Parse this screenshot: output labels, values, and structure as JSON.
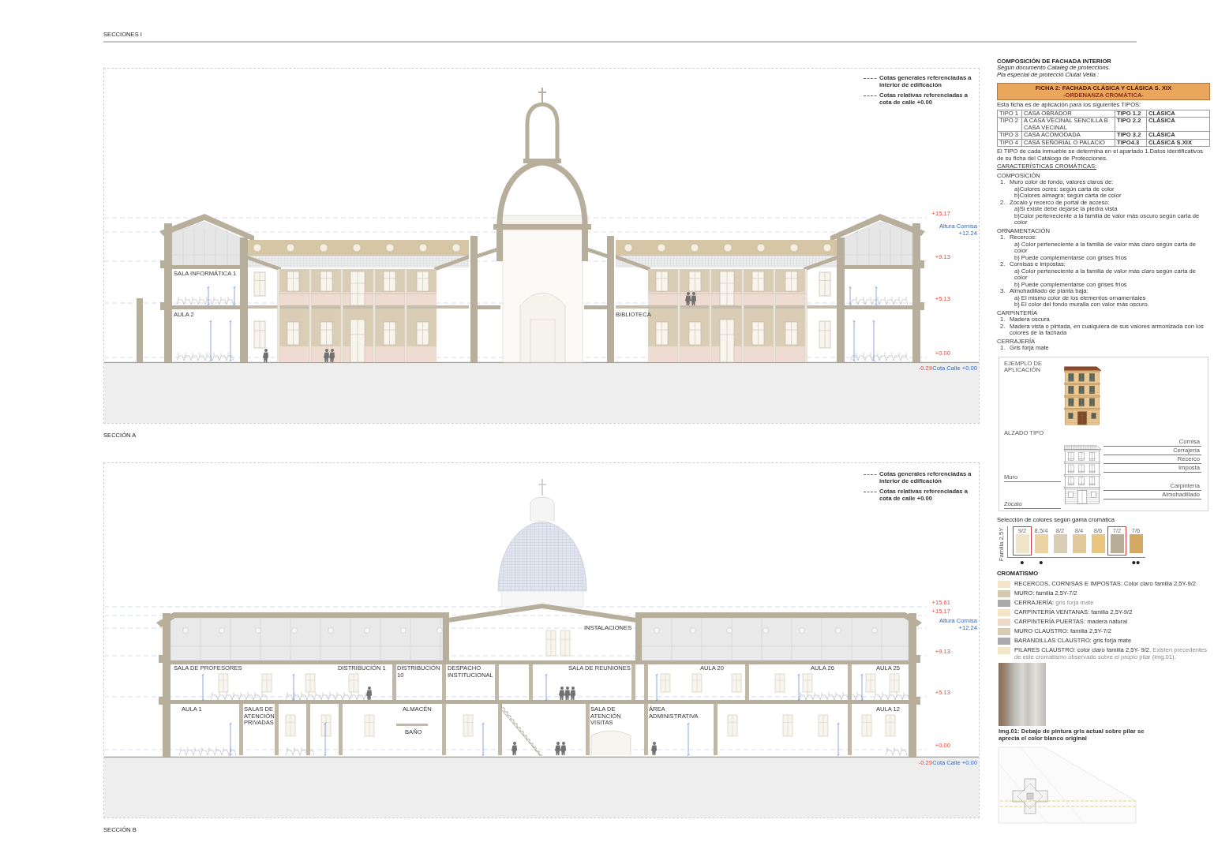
{
  "header": {
    "title": "SECCIONES I"
  },
  "sections": [
    {
      "kind": "chapel",
      "caption": "SECCIÓN A",
      "legend": [
        {
          "kind": "general",
          "text": "Cotas generales referenciadas a interior de edificación"
        },
        {
          "kind": "relative",
          "text": "Cotas relativas referenciadas a cota de calle +0.00"
        }
      ],
      "levels": [
        {
          "text": "+15.17",
          "kind": "general"
        },
        {
          "text": "Altura Cornisa +12.24",
          "kind": "relative"
        },
        {
          "text": "+9.13",
          "kind": "general"
        },
        {
          "text": "+5.13",
          "kind": "general"
        },
        {
          "text": "+0.00",
          "kind": "general"
        },
        {
          "text": "-0.29",
          "kind": "general"
        },
        {
          "text": "Cota Calle +0.00",
          "kind": "relative"
        }
      ],
      "rooms": [
        "SALA INFORMÁTICA 1",
        "AULA 2",
        "BIBLIOTECA"
      ]
    },
    {
      "kind": "offices",
      "caption": "SECCIÓN B",
      "legend": [
        {
          "kind": "general",
          "text": "Cotas generales referenciadas a interior de edificación"
        },
        {
          "kind": "relative",
          "text": "Cotas relativas referenciadas a cota de calle +0.00"
        }
      ],
      "levels": [
        {
          "text": "+15.61",
          "kind": "general"
        },
        {
          "text": "+15.17",
          "kind": "general"
        },
        {
          "text": "Altura Cornisa +12.24",
          "kind": "relative"
        },
        {
          "text": "+9.13",
          "kind": "general"
        },
        {
          "text": "+5.13",
          "kind": "general"
        },
        {
          "text": "+0.00",
          "kind": "general"
        },
        {
          "text": "-0.29",
          "kind": "general"
        },
        {
          "text": "Cota Calle +0.00",
          "kind": "relative"
        }
      ],
      "rooms": [
        "INSTALACIONES",
        "SALA DE PROFESORES",
        "DISTRIBUCIÓN 1",
        "DISTRIBUCIÓN 10",
        "DESPACHO INSTITUCIONAL",
        "SALA DE REUNIONES",
        "AULA 20",
        "AULA 26",
        "AULA 25",
        "AULA 1",
        "SALAS DE ATENCIÓN PRIVADAS",
        "ALMACÉN",
        "BAÑO",
        "SALA DE ATENCIÓN VISITAS",
        "ÁREA ADMINISTRATIVA",
        "AULA 12"
      ]
    }
  ],
  "composition": {
    "title": "COMPOSICIÓN DE FACHADA INTERIOR",
    "source_lines": [
      "Según documento Cataleg de proteccions.",
      "Pla especial de protecció Ciutat Vella :"
    ]
  },
  "ficha": {
    "title": "FICHA 2: FACHADA CLÁSICA Y CLÁSICA S. XIX",
    "subtitle": "-ORDENANZA CROMÁTICA-",
    "intro": "Esta ficha es de aplicación para los siguientes TIPOS:",
    "types_table": {
      "rows": [
        [
          "TIPO 1",
          "CASA OBRADOR",
          "TIPO 1.2",
          "CLÁSICA"
        ],
        [
          "TIPO 2",
          "A CASA VECINAL SENCILLA B CASA VECINAL",
          "TIPO 2.2",
          "CLÁSICA"
        ],
        [
          "TIPO 3",
          "CASA ACOMODADA",
          "TIPO 3.2",
          "CLÁSICA"
        ],
        [
          "TIPO 4",
          "CASA SEÑORIAL O PALACIO",
          "TIPO4.3",
          "CLÁSICA S.XIX"
        ]
      ]
    },
    "note": "El TIPO de cada inmueble se determina en el apartado 1.Datos identificativos de su ficha del Catálogo de Protecciones.",
    "heading": "CARACTERÍSTICAS CROMÁTICAS:",
    "groups": [
      {
        "title": "COMPOSICIÓN",
        "items": [
          {
            "number": "1.",
            "text": "Muro color de fondo, valores claros de:",
            "subitems": [
              "a)Colores ocres: según carta de color",
              "b)Colores almagra: según carta de color"
            ]
          },
          {
            "number": "2.",
            "text": "Zócalo y recerco de portal de acceso:",
            "subitems": [
              "a)Si existe debe dejarse la piedra vista",
              "b)Color perteneciente a la familia de valor más oscuro según carta de color"
            ]
          }
        ]
      },
      {
        "title": "ORNAMENTACIÓN",
        "items": [
          {
            "number": "1.",
            "text": "Recercos:",
            "subitems": [
              "a) Color perteneciente a la familia de valor más claro según carta de color",
              "b) Puede complementarse con grises fríos"
            ]
          },
          {
            "number": "2.",
            "text": "Cornisas e impostas:",
            "subitems": [
              "a) Color perteneciente a la familia de valor más claro según carta de color",
              "b) Puede complementarse con grises fríos"
            ]
          },
          {
            "number": "3.",
            "text": "Almohadillado de planta baja:",
            "subitems": [
              "a) El mismo color de los elementos ornamentales",
              "b) El color del fondo muralla con valor más oscuro."
            ]
          }
        ]
      },
      {
        "title": "CARPINTERÍA",
        "items": [
          {
            "number": "1.",
            "text": "Madera oscura"
          },
          {
            "number": "2.",
            "text": "Madera vista o pintada, en cualquiera de sus valores armonizada con los colores de la fachada"
          }
        ]
      },
      {
        "title": "CERRAJERÍA",
        "items": [
          {
            "number": "1.",
            "text": "Gris forja mate"
          }
        ]
      }
    ]
  },
  "example": {
    "title": "EJEMPLO DE APLICACIÓN",
    "elevation_title": "ALZADO TIPO",
    "callouts": [
      {
        "text": "Cornisa",
        "kind": "right"
      },
      {
        "text": "Cerrajería",
        "kind": "right"
      },
      {
        "text": "Recerco",
        "kind": "right"
      },
      {
        "text": "Imposta",
        "kind": "right"
      },
      {
        "text": "Muro",
        "kind": "left"
      },
      {
        "text": "Carpintería",
        "kind": "right"
      },
      {
        "text": "Almohadillado",
        "kind": "right"
      },
      {
        "text": "Zócalo",
        "kind": "left"
      }
    ]
  },
  "palette": {
    "title": "Selección de colores según gama cromática",
    "family": "Familia 2,5Y",
    "swatches": [
      {
        "label": "9/2",
        "color": "#efe4c9",
        "selected": true,
        "mark": "•"
      },
      {
        "label": "8,5/4",
        "color": "#ecd3a3",
        "selected": false,
        "mark": "•"
      },
      {
        "label": "8/2",
        "color": "#d9cdb5",
        "selected": false
      },
      {
        "label": "8/4",
        "color": "#e2c99b",
        "selected": false
      },
      {
        "label": "8/6",
        "color": "#e8c680",
        "selected": false
      },
      {
        "label": "7/2",
        "color": "#b8ad97",
        "selected": true
      },
      {
        "label": "7/6",
        "color": "#d4a964",
        "selected": false,
        "mark": "••"
      }
    ]
  },
  "chromatism": {
    "title": "CROMATISMO",
    "groups": [
      {
        "items": [
          {
            "text": "RECERCOS, CORNISAS E IMPOSTAS: Color claro familia 2,5Y-9/2",
            "color": "#f4e6cb"
          },
          {
            "text": "MURO: familia 2,5Y-7/2",
            "color": "#d3c8b0"
          },
          {
            "text": "CERRAJERÍA:",
            "note": "gris forja mate",
            "color": "#ababab"
          }
        ]
      },
      {
        "items": [
          {
            "text": "CARPINTERÍA VENTANAS: familia 2,5Y-9/2",
            "color": "#f4e5c6"
          },
          {
            "text": "CARPINTERÍA PUERTAS: madera natural",
            "color": "#ecd9c9"
          },
          {
            "text": "MURO CLAUSTRO: familia 2,5Y-7/2",
            "color": "#d6cbb3"
          },
          {
            "text": "BARANDILLAS CLAUSTRO: gris forja mate",
            "color": "#aaaaac"
          },
          {
            "text": "PILARES CLAUSTRO: color claro familia 2,5Y- 9/2.",
            "note": "Existen precedentes de este cromatismo observado sobre el propio pilar (img.01).",
            "color": "#f4e6c8"
          }
        ]
      }
    ]
  },
  "photo": {
    "caption": "Img.01: Debajo de pintura gris actual sobre pilar se aprecia el color blanco original"
  }
}
